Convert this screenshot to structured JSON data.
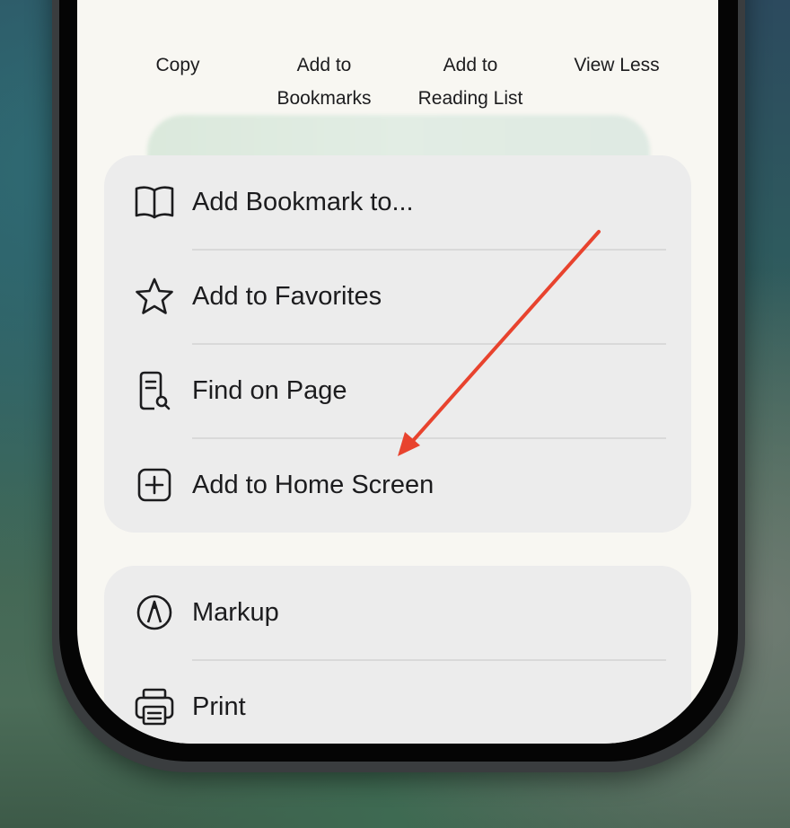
{
  "quick_actions": [
    {
      "label": "Copy",
      "icon": "copy-icon"
    },
    {
      "label_line1": "Add to",
      "label_line2": "Bookmarks",
      "icon": "bookmark-icon"
    },
    {
      "label_line1": "Add to",
      "label_line2": "Reading List",
      "icon": "glasses-icon"
    },
    {
      "label": "View Less",
      "icon": "ellipsis-icon"
    }
  ],
  "menu_group_1": [
    {
      "label": "Add Bookmark to...",
      "icon": "book-icon"
    },
    {
      "label": "Add to Favorites",
      "icon": "star-icon"
    },
    {
      "label": "Find on Page",
      "icon": "find-on-page-icon"
    },
    {
      "label": "Add to Home Screen",
      "icon": "plus-square-icon"
    }
  ],
  "menu_group_2": [
    {
      "label": "Markup",
      "icon": "markup-pen-icon"
    },
    {
      "label": "Print",
      "icon": "printer-icon"
    }
  ],
  "annotation": {
    "arrow_color": "#e8432e",
    "points_to": "Add to Home Screen"
  },
  "colors": {
    "screen_bg": "#f8f7f2",
    "menu_bg": "#ececec",
    "text": "#1c1c1e"
  }
}
